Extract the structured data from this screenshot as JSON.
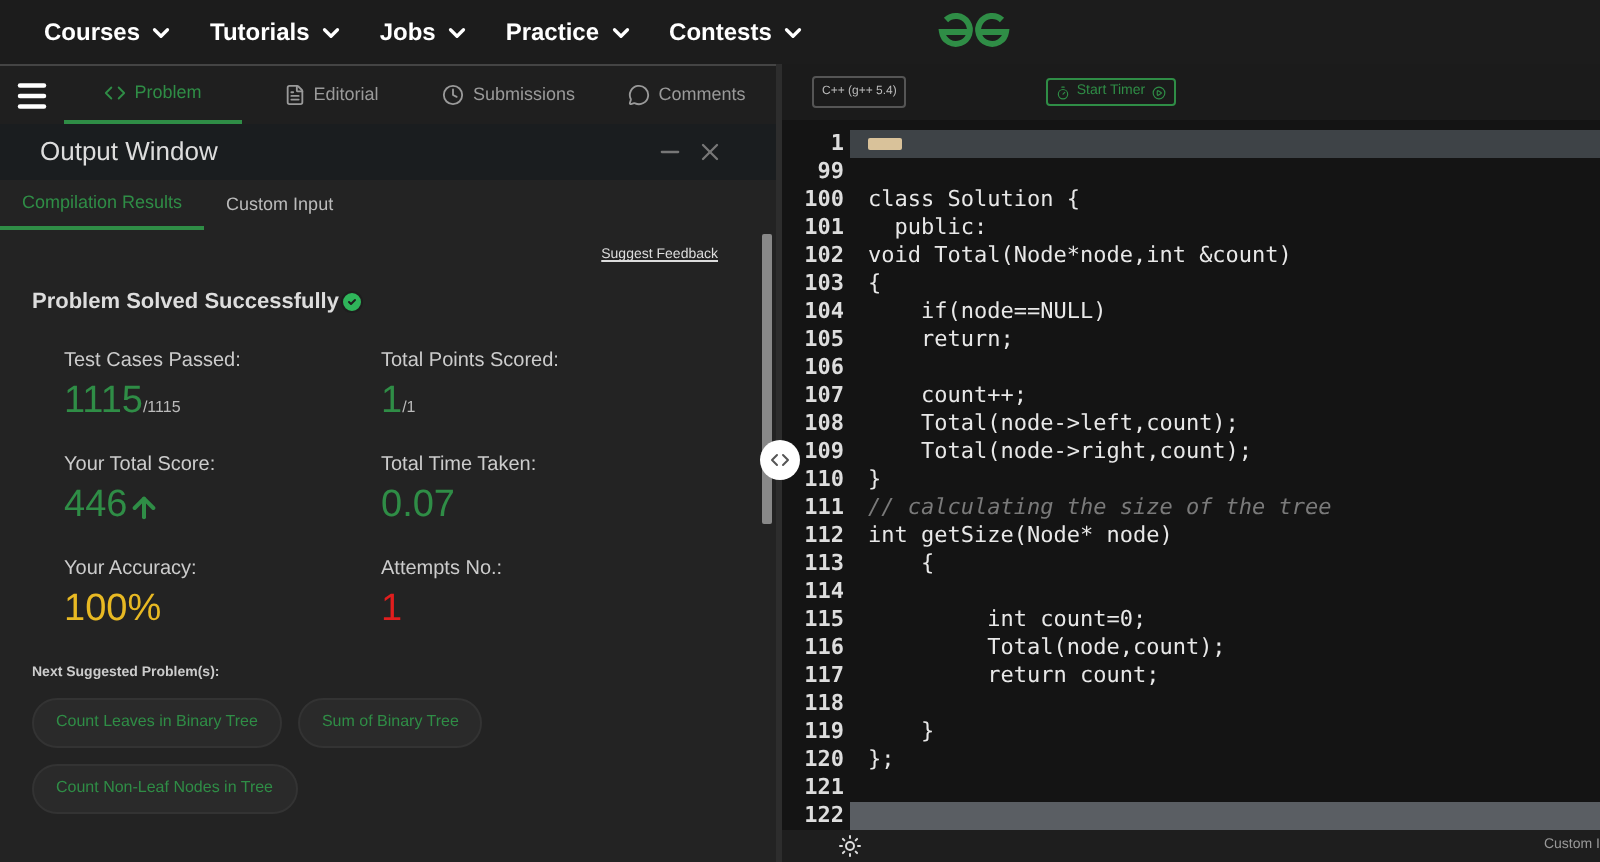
{
  "nav": {
    "items": [
      {
        "label": "Courses"
      },
      {
        "label": "Tutorials"
      },
      {
        "label": "Jobs"
      },
      {
        "label": "Practice"
      },
      {
        "label": "Contests"
      }
    ]
  },
  "problem_tabs": [
    {
      "label": "Problem",
      "selected": true
    },
    {
      "label": "Editorial",
      "selected": false
    },
    {
      "label": "Submissions",
      "selected": false
    },
    {
      "label": "Comments",
      "selected": false
    }
  ],
  "output_window": {
    "title": "Output Window",
    "tabs": [
      {
        "label": "Compilation Results",
        "selected": true
      },
      {
        "label": "Custom Input",
        "selected": false
      }
    ],
    "feedback_link": "Suggest Feedback",
    "status": "Problem Solved Successfully",
    "stats": [
      {
        "label": "Test Cases Passed:",
        "value": "1115",
        "suffix": "/1115",
        "color": "#2f8d46",
        "arrow": false
      },
      {
        "label": "Total Points Scored:",
        "value": "1",
        "suffix": "/1",
        "color": "#2f8d46",
        "arrow": false
      },
      {
        "label": "Your Total Score:",
        "value": "446",
        "color": "#2f8d46",
        "arrow": true
      },
      {
        "label": "Total Time Taken:",
        "value": "0.07",
        "color": "#2f8d46",
        "arrow": false
      },
      {
        "label": "Your Accuracy:",
        "value": "100%",
        "color": "#e8b923",
        "arrow": false
      },
      {
        "label": "Attempts No.:",
        "value": "1",
        "color": "#e01e1e",
        "arrow": false
      }
    ],
    "suggested_heading": "Next Suggested Problem(s):",
    "suggested": [
      "Count Leaves in Binary Tree",
      "Sum of Binary Tree",
      "Count Non-Leaf Nodes in Tree"
    ]
  },
  "editor": {
    "language": "C++ (g++ 5.4)",
    "timer_button": "Start Timer",
    "lines": [
      {
        "number": "1",
        "kind": "folded"
      },
      {
        "number": "99",
        "kind": "code"
      },
      {
        "number": "100",
        "kind": "code",
        "text": "class Solution {"
      },
      {
        "number": "101",
        "kind": "code",
        "text": "  public:"
      },
      {
        "number": "102",
        "kind": "code",
        "text": "void Total(Node*node,int &count)"
      },
      {
        "number": "103",
        "kind": "code",
        "text": "{"
      },
      {
        "number": "104",
        "kind": "code",
        "text": "    if(node==NULL)"
      },
      {
        "number": "105",
        "kind": "code",
        "text": "    return;"
      },
      {
        "number": "106",
        "kind": "code"
      },
      {
        "number": "107",
        "kind": "code",
        "text": "    count++;"
      },
      {
        "number": "108",
        "kind": "code",
        "text": "    Total(node->left,count);"
      },
      {
        "number": "109",
        "kind": "code",
        "text": "    Total(node->right,count);"
      },
      {
        "number": "110",
        "kind": "code",
        "text": "}"
      },
      {
        "number": "111",
        "kind": "comment",
        "text": "// calculating the size of the tree"
      },
      {
        "number": "112",
        "kind": "code",
        "text": "int getSize(Node* node)"
      },
      {
        "number": "113",
        "kind": "code",
        "text": "    {"
      },
      {
        "number": "114",
        "kind": "code"
      },
      {
        "number": "115",
        "kind": "code",
        "text": "         int count=0;"
      },
      {
        "number": "116",
        "kind": "code",
        "text": "         Total(node,count);"
      },
      {
        "number": "117",
        "kind": "code",
        "text": "         return count;"
      },
      {
        "number": "118",
        "kind": "code"
      },
      {
        "number": "119",
        "kind": "code",
        "text": "    }"
      },
      {
        "number": "120",
        "kind": "code",
        "text": "};"
      },
      {
        "number": "121",
        "kind": "code"
      },
      {
        "number": "122",
        "kind": "highlighted"
      }
    ]
  },
  "bottom_bar": {
    "right_text": "Custom I"
  }
}
